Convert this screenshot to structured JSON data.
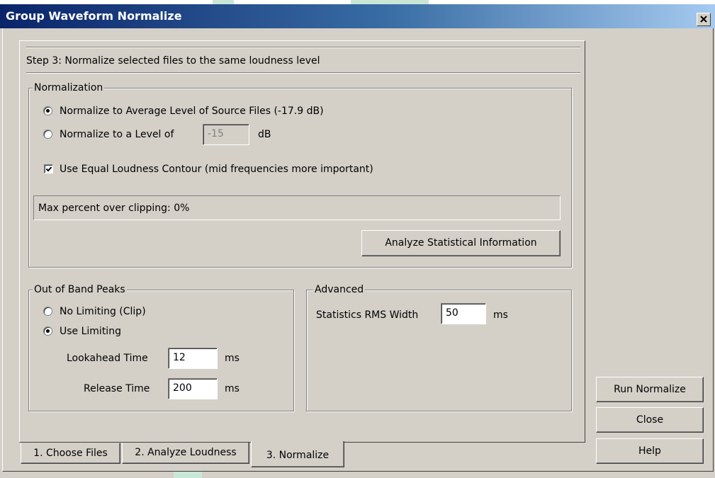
{
  "window": {
    "title": "Group Waveform Normalize",
    "close_glyph": "✕"
  },
  "step": {
    "heading": "Step 3:  Normalize selected files to the same loudness level"
  },
  "normalization": {
    "group_label": "Normalization",
    "option_average": "Normalize to Average Level of Source Files (-17.9 dB)",
    "option_average_selected": true,
    "option_level": "Normalize to a Level of",
    "level_value": "-15",
    "level_unit": "dB",
    "equal_loudness_label": "Use Equal Loudness Contour (mid frequencies more important)",
    "equal_loudness_checked": true,
    "clipping_status": "Max percent over clipping: 0%",
    "analyze_button": "Analyze Statistical Information"
  },
  "out_of_band": {
    "group_label": "Out of Band Peaks",
    "option_no_limiting": "No Limiting (Clip)",
    "option_use_limiting": "Use Limiting",
    "use_limiting_selected": true,
    "lookahead_label": "Lookahead Time",
    "lookahead_value": "12",
    "lookahead_unit": "ms",
    "release_label": "Release Time",
    "release_value": "200",
    "release_unit": "ms"
  },
  "advanced": {
    "group_label": "Advanced",
    "rms_label": "Statistics RMS Width",
    "rms_value": "50",
    "rms_unit": "ms"
  },
  "tabs": [
    {
      "label": "1. Choose Files",
      "active": false
    },
    {
      "label": "2. Analyze Loudness",
      "active": false
    },
    {
      "label": "3. Normalize",
      "active": true
    }
  ],
  "buttons": {
    "run": "Run Normalize",
    "close": "Close",
    "help": "Help"
  }
}
